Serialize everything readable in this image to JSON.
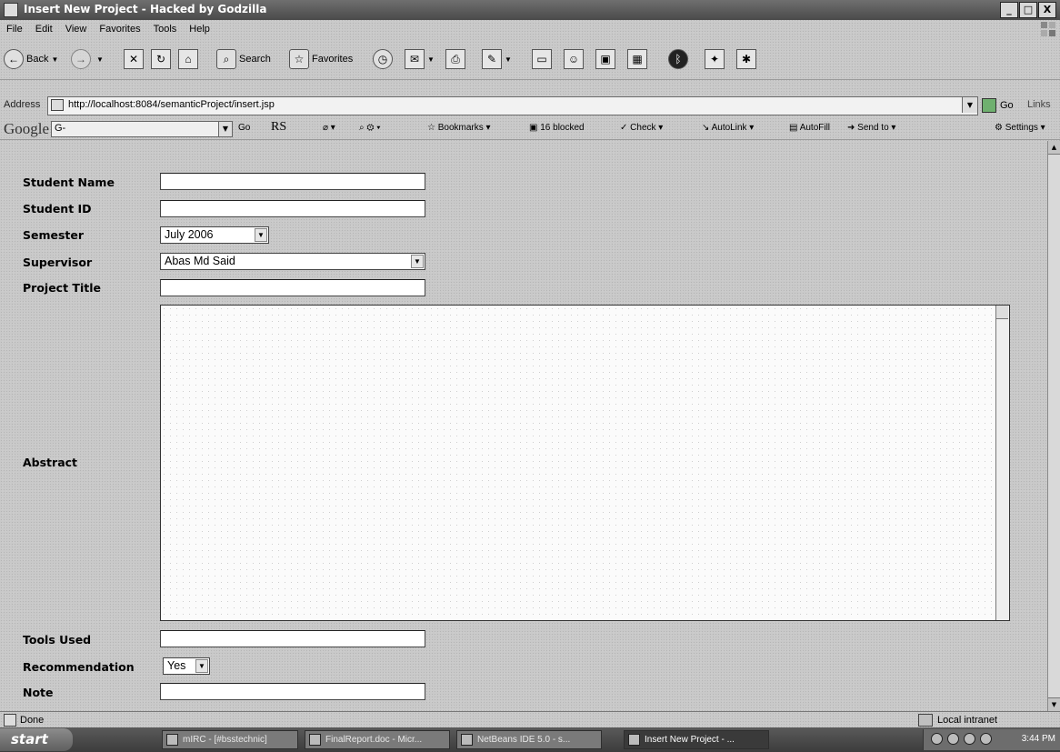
{
  "window": {
    "title": "Insert New Project - Hacked by Godzilla",
    "minimize": "_",
    "maximize": "□",
    "close": "X"
  },
  "menu": [
    "File",
    "Edit",
    "View",
    "Favorites",
    "Tools",
    "Help"
  ],
  "toolbar": {
    "back": "Back",
    "search": "Search",
    "favorites": "Favorites"
  },
  "address": {
    "label": "Address",
    "url": "http://localhost:8084/semanticProject/insert.jsp",
    "go": "Go",
    "links": "Links"
  },
  "google_toolbar": {
    "logo": "Google",
    "search_value": "G-",
    "go": "Go",
    "rs": "RS",
    "bookmarks": "Bookmarks",
    "blocked": "16 blocked",
    "check": "Check",
    "autolink": "AutoLink",
    "autofill": "AutoFill",
    "send_to": "Send to",
    "settings": "Settings"
  },
  "form": {
    "student_name_label": "Student Name",
    "student_name_value": "",
    "student_id_label": "Student ID",
    "student_id_value": "",
    "semester_label": "Semester",
    "semester_value": "July 2006",
    "supervisor_label": "Supervisor",
    "supervisor_value": "Abas Md Said",
    "project_title_label": "Project Title",
    "project_title_value": "",
    "abstract_label": "Abstract",
    "abstract_value": "",
    "tools_used_label": "Tools Used",
    "tools_used_value": "",
    "recommendation_label": "Recommendation",
    "recommendation_value": "Yes",
    "note_label": "Note",
    "note_value": ""
  },
  "status": {
    "text": "Done",
    "zone": "Local intranet"
  },
  "taskbar": {
    "start": "start",
    "tasks": [
      "mIRC - [#bsstechnic]",
      "FinalReport.doc - Micr...",
      "NetBeans IDE 5.0 - s...",
      "Insert New Project - ..."
    ],
    "clock": "3:44 PM"
  }
}
